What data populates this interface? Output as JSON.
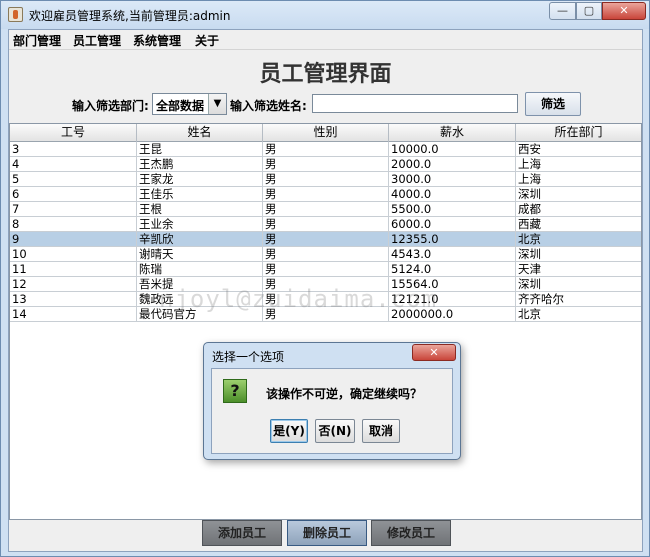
{
  "window": {
    "title": "欢迎雇员管理系统,当前管理员:admin",
    "minimize_label": "—",
    "maximize_label": "▢",
    "close_label": "✕"
  },
  "menu": [
    "部门管理",
    "员工管理",
    "系统管理",
    "关于"
  ],
  "page_title": "员工管理界面",
  "filter": {
    "dept_label": "输入筛选部门:",
    "dept_selected": "全部数据",
    "name_label": "输入筛选姓名:",
    "name_value": "",
    "button_label": "筛选"
  },
  "table": {
    "columns": [
      "工号",
      "姓名",
      "性别",
      "薪水",
      "所在部门"
    ],
    "rows": [
      [
        "3",
        "王昆",
        "男",
        "10000.0",
        "西安"
      ],
      [
        "4",
        "王杰鹏",
        "男",
        "2000.0",
        "上海"
      ],
      [
        "5",
        "王家龙",
        "男",
        "3000.0",
        "上海"
      ],
      [
        "6",
        "王佳乐",
        "男",
        "4000.0",
        "深圳"
      ],
      [
        "7",
        "王根",
        "男",
        "5500.0",
        "成都"
      ],
      [
        "8",
        "王业余",
        "男",
        "6000.0",
        "西藏"
      ],
      [
        "9",
        "辛凯欣",
        "男",
        "12355.0",
        "北京"
      ],
      [
        "10",
        "谢晴天",
        "男",
        "4543.0",
        "深圳"
      ],
      [
        "11",
        "陈瑞",
        "男",
        "5124.0",
        "天津"
      ],
      [
        "12",
        "吾米提",
        "男",
        "15564.0",
        "深圳"
      ],
      [
        "13",
        "魏政远",
        "男",
        "12121.0",
        "齐齐哈尔"
      ],
      [
        "14",
        "最代码官方",
        "男",
        "2000000.0",
        "北京"
      ]
    ],
    "selected_row_index": 6
  },
  "watermark": "njoyl@zuidaima.com",
  "actions": {
    "add_label": "添加员工",
    "delete_label": "删除员工",
    "edit_label": "修改员工"
  },
  "dialog": {
    "title": "选择一个选项",
    "close_label": "✕",
    "icon_glyph": "?",
    "message": "该操作不可逆，确定继续吗？",
    "yes_label": "是(Y)",
    "no_label": "否(N)",
    "cancel_label": "取消"
  }
}
